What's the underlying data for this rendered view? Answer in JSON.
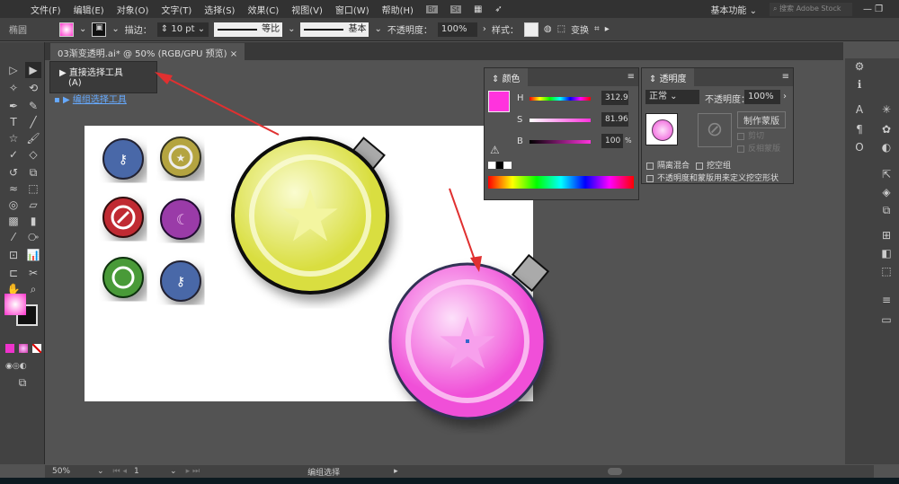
{
  "menu": [
    "文件(F)",
    "编辑(E)",
    "对象(O)",
    "文字(T)",
    "选择(S)",
    "效果(C)",
    "视图(V)",
    "窗口(W)",
    "帮助(H)"
  ],
  "app_icons": [
    "Br",
    "St"
  ],
  "workspace": "基本功能",
  "search_placeholder": "搜索 Adobe Stock",
  "control": {
    "object": "椭圆",
    "stroke_label": "描边：",
    "stroke_value": "10 pt",
    "profile": "等比",
    "brush": "基本",
    "opacity_label": "不透明度：",
    "opacity": "100%",
    "style_label": "样式：",
    "transform": "变换"
  },
  "tab": {
    "title": "03渐变透明.ai* @ 50% (RGB/GPU 预览)",
    "close": "×"
  },
  "flyout": {
    "item1": "直接选择工具",
    "item1_key": "(A)",
    "item2": "编组选择工具"
  },
  "color_panel": {
    "title": "颜色",
    "h_label": "H",
    "h": "312.9",
    "s_label": "S",
    "s": "81.96",
    "b_label": "B",
    "b": "100",
    "pct": "%",
    "deg": "°",
    "fill_color": "#ff33dd"
  },
  "transparency_panel": {
    "title": "透明度",
    "mode": "正常",
    "opacity_label": "不透明度：",
    "opacity": "100%",
    "make_mask": "制作蒙版",
    "clip": "剪切",
    "invert": "反相蒙版",
    "isolate": "隔离混合",
    "knockout": "挖空组",
    "define_knockout": "不透明度和蒙版用来定义挖空形状"
  },
  "status": {
    "zoom": "50%",
    "page": "1",
    "tool": "编组选择"
  },
  "colors": {
    "accent_arrow": "#e03030",
    "pink": "#ff55dd",
    "yellow": "#e8ec70"
  }
}
